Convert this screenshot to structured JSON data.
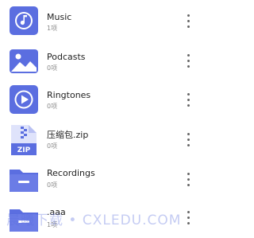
{
  "colors": {
    "accent": "#5b6ee0",
    "title": "#222222",
    "subtitle": "#8a8a8a"
  },
  "items": [
    {
      "title": "Music",
      "count": "1项",
      "icon": "music-note-icon"
    },
    {
      "title": "Podcasts",
      "count": "0项",
      "icon": "image-landscape-icon"
    },
    {
      "title": "Ringtones",
      "count": "0项",
      "icon": "play-circle-icon"
    },
    {
      "title": "压缩包.zip",
      "count": "0项",
      "icon": "zip-file-icon"
    },
    {
      "title": "Recordings",
      "count": "0项",
      "icon": "folder-icon"
    },
    {
      "title": ".aaa",
      "count": "1项",
      "icon": "folder-icon"
    }
  ],
  "watermark": "晨曦下载 • CXLEDU.COM"
}
